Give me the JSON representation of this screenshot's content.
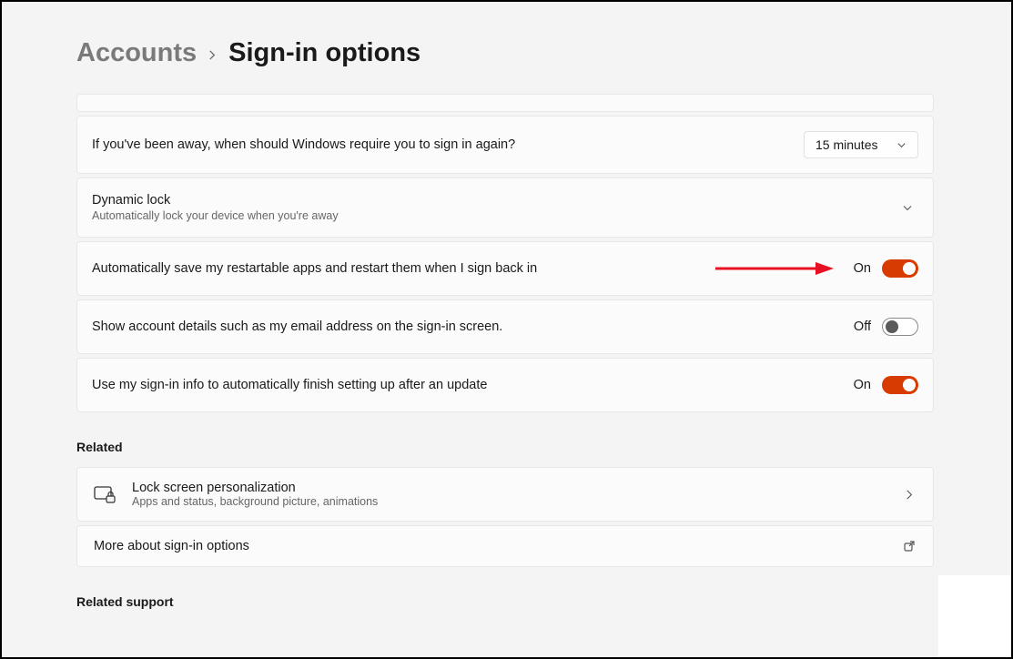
{
  "breadcrumb": {
    "parent": "Accounts",
    "current": "Sign-in options"
  },
  "settings": {
    "require_signin": {
      "label": "If you've been away, when should Windows require you to sign in again?",
      "value": "15 minutes"
    },
    "dynamic_lock": {
      "title": "Dynamic lock",
      "subtitle": "Automatically lock your device when you're away"
    },
    "restartable_apps": {
      "label": "Automatically save my restartable apps and restart them when I sign back in",
      "state_label": "On",
      "on": true
    },
    "show_account_details": {
      "label": "Show account details such as my email address on the sign-in screen.",
      "state_label": "Off",
      "on": false
    },
    "use_signin_after_update": {
      "label": "Use my sign-in info to automatically finish setting up after an update",
      "state_label": "On",
      "on": true
    }
  },
  "related": {
    "heading": "Related",
    "lock_screen": {
      "title": "Lock screen personalization",
      "subtitle": "Apps and status, background picture, animations"
    },
    "more_about": {
      "title": "More about sign-in options"
    }
  },
  "related_support": {
    "heading": "Related support"
  },
  "colors": {
    "accent": "#d83b01",
    "arrow": "#e81123"
  }
}
